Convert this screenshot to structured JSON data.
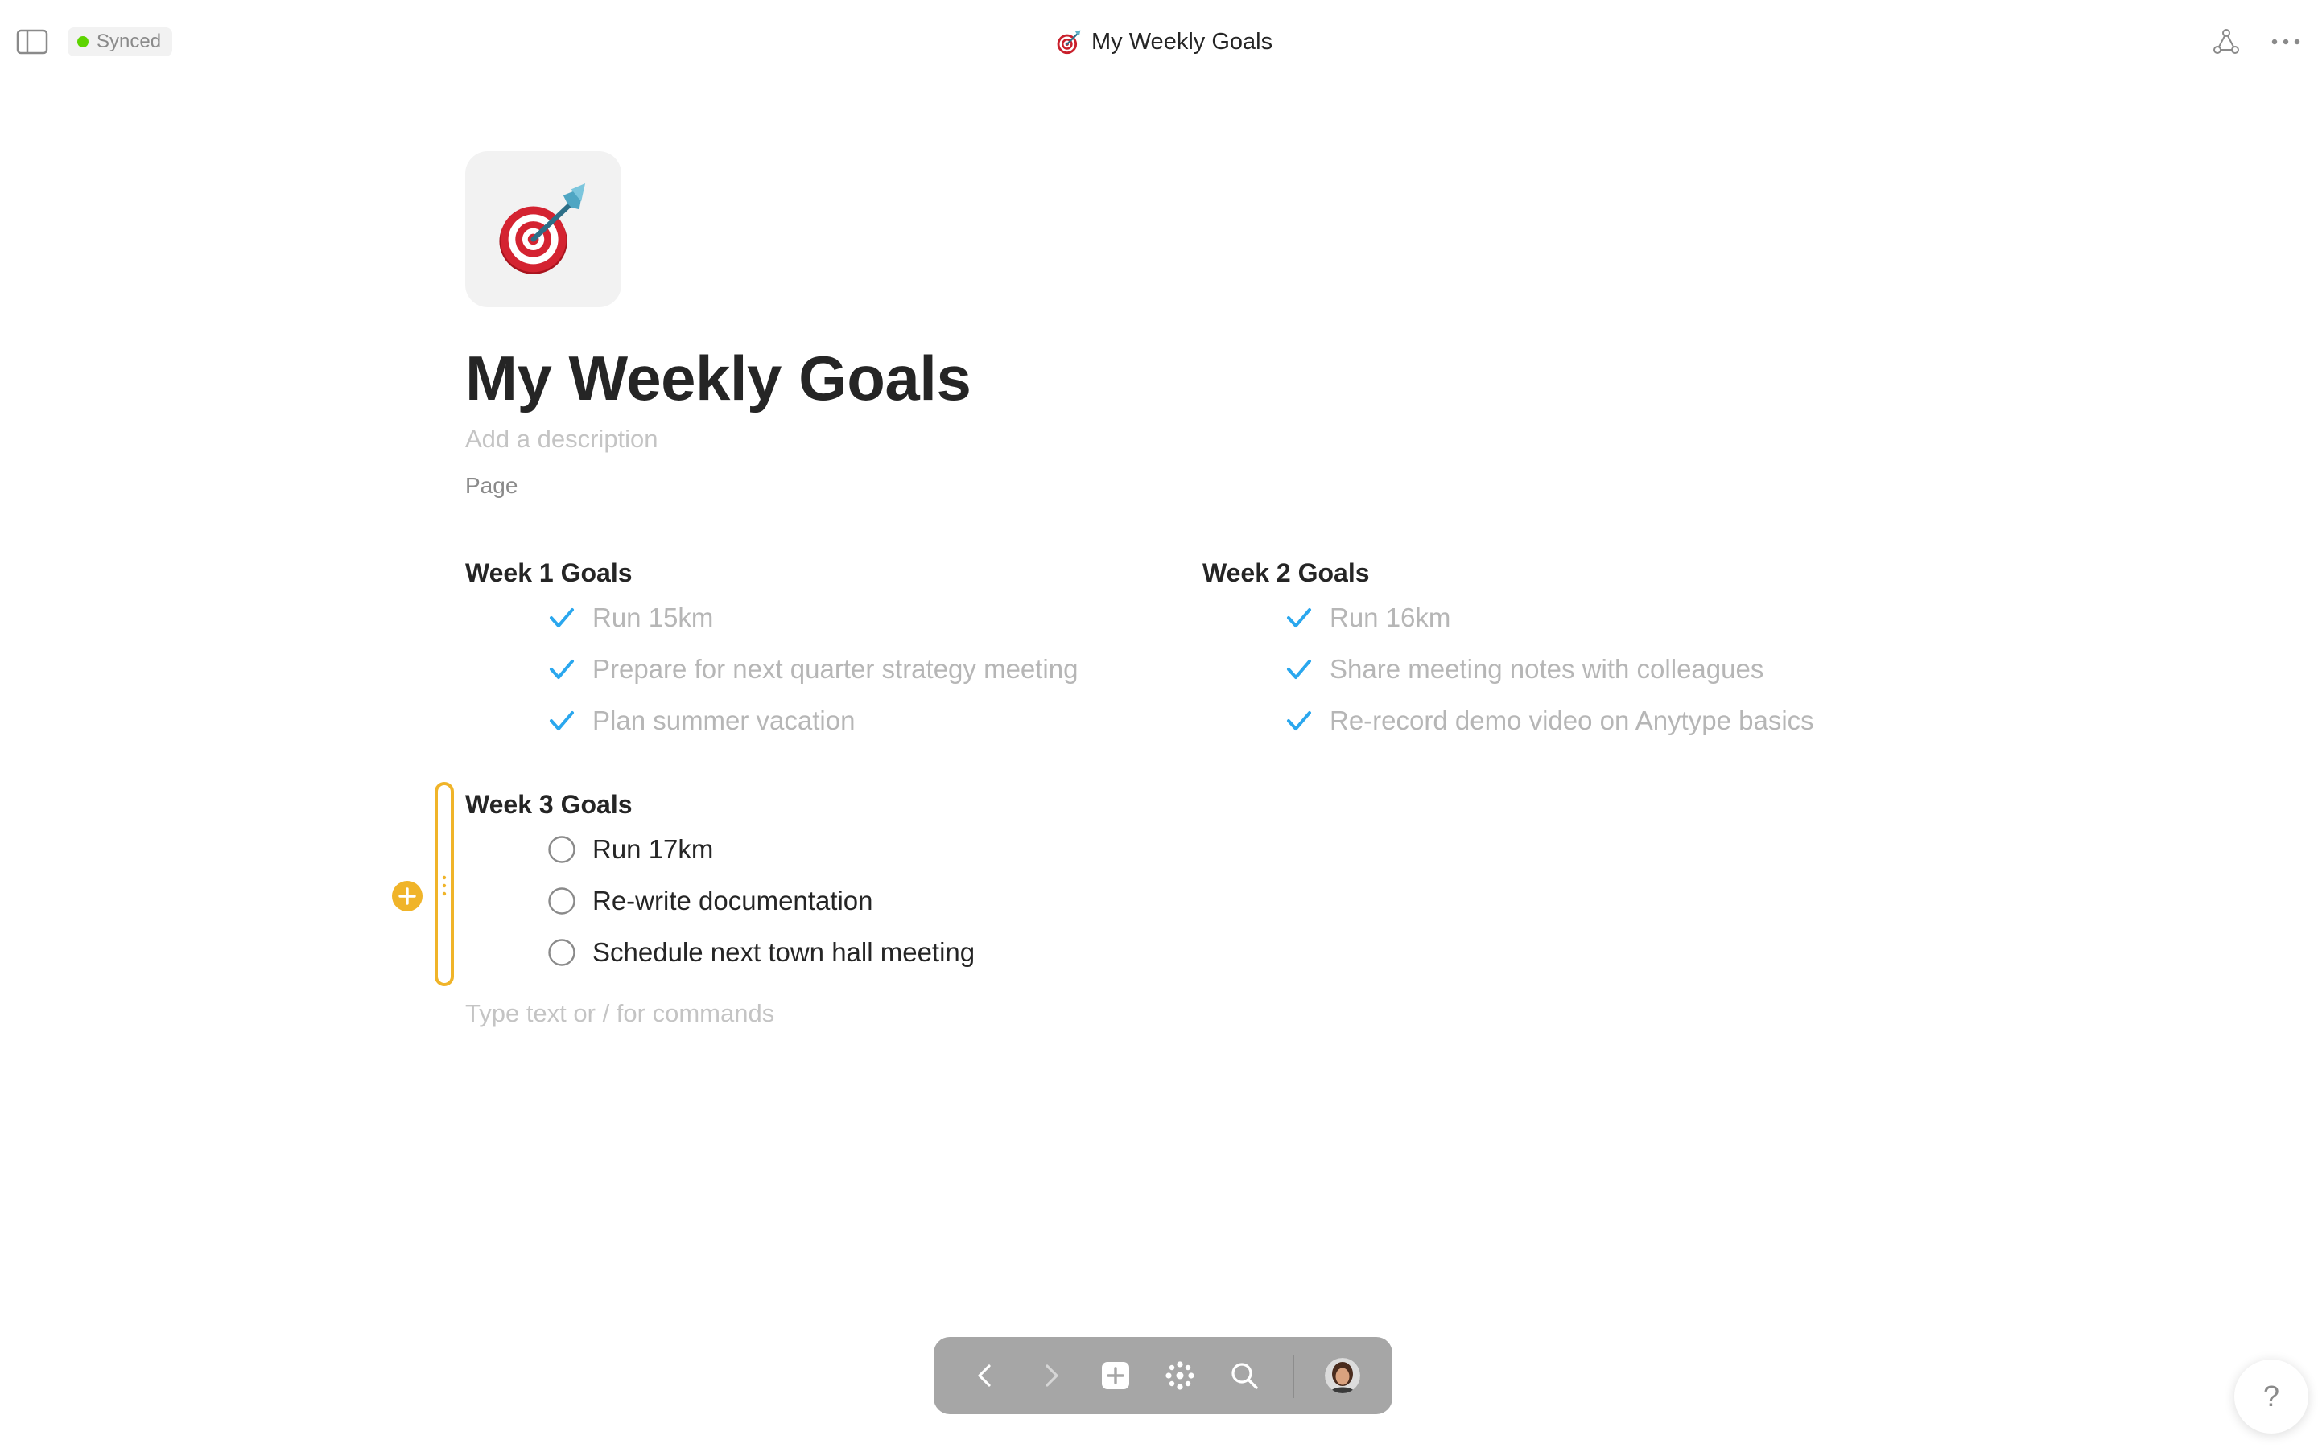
{
  "topbar": {
    "sync_status": "Synced",
    "window_title": "My Weekly Goals"
  },
  "page": {
    "title": "My Weekly Goals",
    "description_placeholder": "Add a description",
    "object_type": "Page",
    "icon": "bullseye-dart-icon"
  },
  "weeks": [
    {
      "heading": "Week 1 Goals",
      "tasks": [
        {
          "label": "Run 15km",
          "done": true
        },
        {
          "label": "Prepare for next quarter strategy meeting",
          "done": true
        },
        {
          "label": "Plan summer vacation",
          "done": true
        }
      ]
    },
    {
      "heading": "Week 2 Goals",
      "tasks": [
        {
          "label": "Run 16km",
          "done": true
        },
        {
          "label": "Share meeting notes with colleagues",
          "done": true
        },
        {
          "label": "Re-record demo video on Anytype basics",
          "done": true
        }
      ]
    },
    {
      "heading": "Week 3 Goals",
      "tasks": [
        {
          "label": "Run 17km",
          "done": false
        },
        {
          "label": "Re-write documentation",
          "done": false
        },
        {
          "label": "Schedule next town hall meeting",
          "done": false
        }
      ]
    }
  ],
  "editor": {
    "command_placeholder": "Type text or / for commands"
  },
  "help": {
    "label": "?"
  },
  "colors": {
    "synced_dot": "#5dd400",
    "check": "#2aa7ee",
    "selection": "#f0b429",
    "nav_bg": "#a6a6a6"
  }
}
